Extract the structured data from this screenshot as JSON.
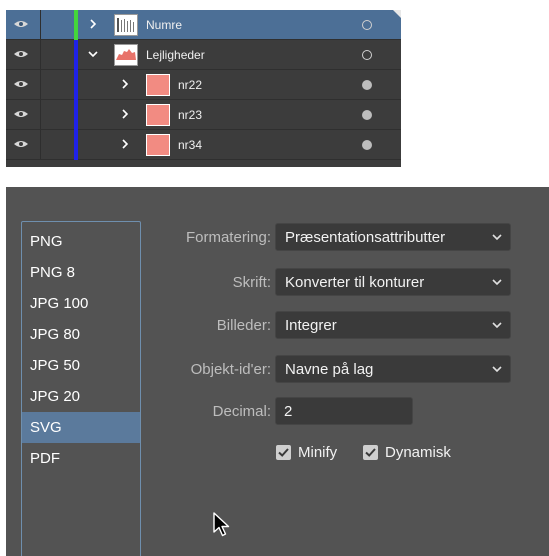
{
  "layers": {
    "rows": [
      {
        "name": "Numre",
        "expanded": false,
        "indent": 0,
        "color": "#44d63a",
        "thumb": "numre",
        "target": "open"
      },
      {
        "name": "Lejligheder",
        "expanded": true,
        "indent": 0,
        "color": "#1f22e8",
        "thumb": "lejligheder",
        "target": "open"
      },
      {
        "name": "nr22",
        "expanded": false,
        "indent": 1,
        "color": "#1f22e8",
        "thumb": "salmon",
        "target": "filled"
      },
      {
        "name": "nr23",
        "expanded": false,
        "indent": 1,
        "color": "#1f22e8",
        "thumb": "salmon",
        "target": "filled"
      },
      {
        "name": "nr34",
        "expanded": false,
        "indent": 1,
        "color": "#1f22e8",
        "thumb": "salmon",
        "target": "filled"
      }
    ]
  },
  "export": {
    "formats": [
      "PNG",
      "PNG 8",
      "JPG 100",
      "JPG 80",
      "JPG 50",
      "JPG 20",
      "SVG",
      "PDF"
    ],
    "selected_format": "SVG",
    "options": [
      {
        "label": "Formatering:",
        "value": "Præsentationsattributter",
        "type": "select"
      },
      {
        "label": "Skrift:",
        "value": "Konverter til konturer",
        "type": "select"
      },
      {
        "label": "Billeder:",
        "value": "Integrer",
        "type": "select"
      },
      {
        "label": "Objekt-id'er:",
        "value": "Navne på lag",
        "type": "select"
      }
    ],
    "decimal": {
      "label": "Decimal:",
      "value": "2"
    },
    "checkboxes": [
      {
        "label": "Minify",
        "checked": true
      },
      {
        "label": "Dynamisk",
        "checked": true
      }
    ]
  },
  "colors": {
    "selected_row": "#4c6f96",
    "panel_bg": "#535353",
    "layers_bg": "#3c3c3c",
    "thumb_salmon": "#f28b82"
  }
}
